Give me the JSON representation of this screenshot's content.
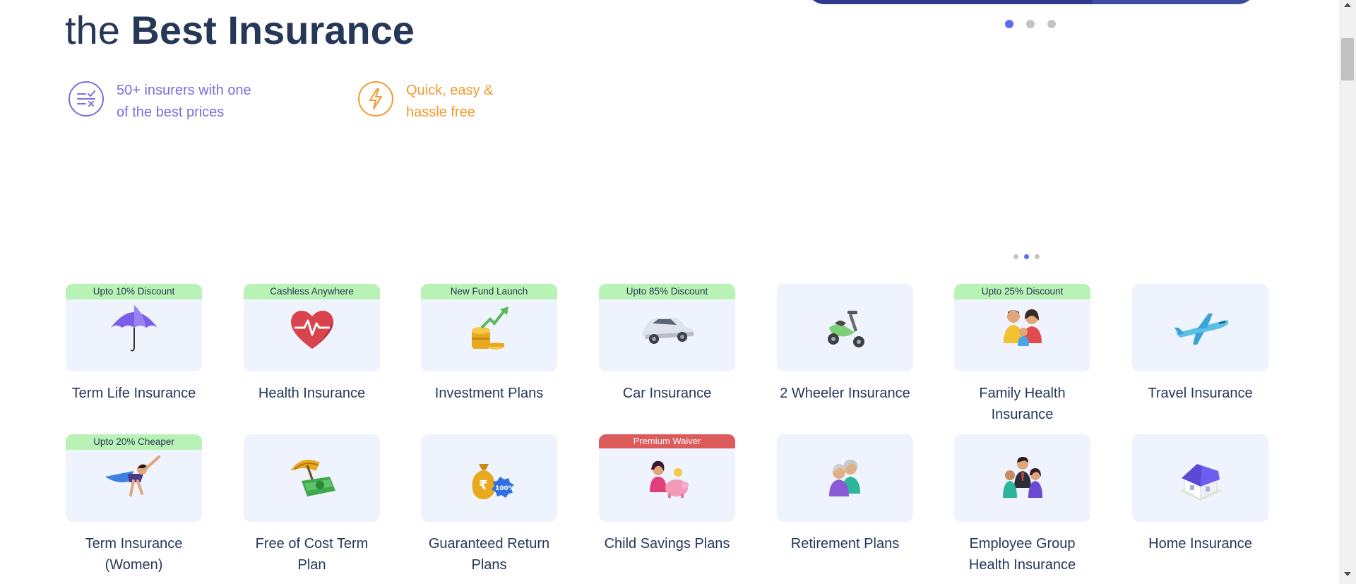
{
  "hero": {
    "headline_light": "the ",
    "headline_bold": "Best Insurance"
  },
  "features": [
    {
      "icon": "compare-icon",
      "text_line1": "50+ insurers with one",
      "text_line2": "of the best prices",
      "color": "#7a6ee0"
    },
    {
      "icon": "lightning-icon",
      "text_line1": "Quick, easy &",
      "text_line2": "hassle free",
      "color": "#f29a2e"
    }
  ],
  "carousel": {
    "slides": 3,
    "active": 1
  },
  "products": [
    {
      "tag": "Upto 10% Discount",
      "tag_style": "green",
      "icon": "umbrella-icon",
      "name": "Term Life Insurance"
    },
    {
      "tag": "Cashless Anywhere",
      "tag_style": "green",
      "icon": "heart-pulse-icon",
      "name": "Health Insurance"
    },
    {
      "tag": "New Fund Launch",
      "tag_style": "green",
      "icon": "coins-growth-icon",
      "name": "Investment Plans"
    },
    {
      "tag": "Upto 85% Discount",
      "tag_style": "green",
      "icon": "car-icon",
      "name": "Car Insurance"
    },
    {
      "tag": "",
      "tag_style": "",
      "icon": "scooter-icon",
      "name": "2 Wheeler Insurance"
    },
    {
      "tag": "Upto 25% Discount",
      "tag_style": "green",
      "icon": "family-icon",
      "name": "Family Health Insurance"
    },
    {
      "tag": "",
      "tag_style": "",
      "icon": "airplane-icon",
      "name": "Travel Insurance"
    },
    {
      "tag": "Upto 20% Cheaper",
      "tag_style": "green",
      "icon": "superwoman-icon",
      "name": "Term Insurance (Women)"
    },
    {
      "tag": "",
      "tag_style": "",
      "icon": "umbrella-money-icon",
      "name": "Free of Cost Term Plan"
    },
    {
      "tag": "",
      "tag_style": "",
      "icon": "money-bag-icon",
      "name": "Guaranteed Return Plans"
    },
    {
      "tag": "Premium Waiver",
      "tag_style": "red",
      "icon": "child-piggybank-icon",
      "name": "Child Savings Plans"
    },
    {
      "tag": "",
      "tag_style": "",
      "icon": "elderly-couple-icon",
      "name": "Retirement Plans"
    },
    {
      "tag": "",
      "tag_style": "",
      "icon": "employee-group-icon",
      "name": "Employee Group Health Insurance"
    },
    {
      "tag": "",
      "tag_style": "",
      "icon": "house-icon",
      "name": "Home Insurance"
    }
  ]
}
